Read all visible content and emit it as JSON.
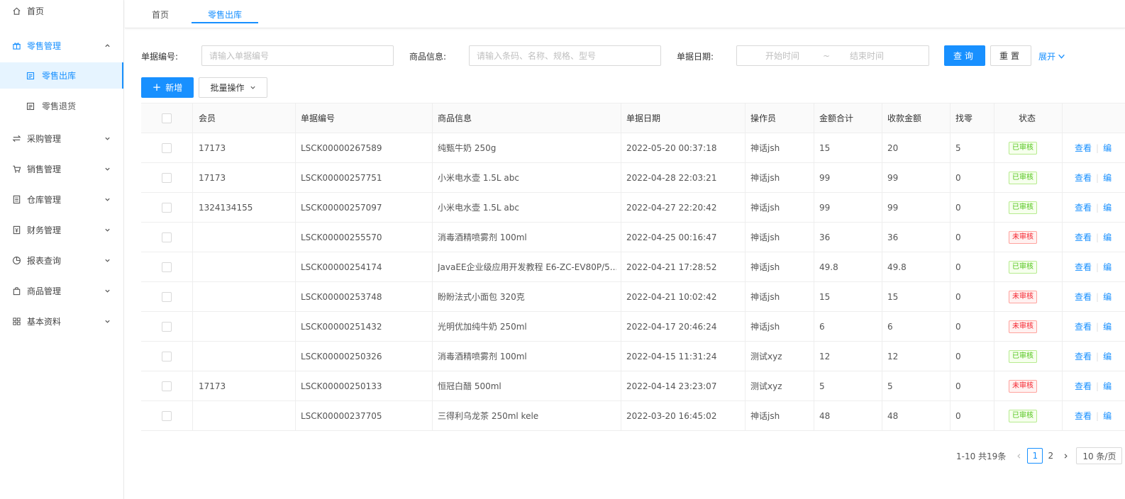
{
  "sidebar": {
    "items": [
      {
        "label": "首页",
        "icon": "home-icon"
      },
      {
        "label": "零售管理",
        "icon": "gift-icon",
        "open": true,
        "children": [
          {
            "label": "零售出库",
            "icon": "document-icon",
            "active": true
          },
          {
            "label": "零售退货",
            "icon": "document-icon"
          }
        ]
      },
      {
        "label": "采购管理",
        "icon": "swap-icon"
      },
      {
        "label": "销售管理",
        "icon": "cart-icon"
      },
      {
        "label": "仓库管理",
        "icon": "warehouse-icon"
      },
      {
        "label": "财务管理",
        "icon": "finance-icon"
      },
      {
        "label": "报表查询",
        "icon": "pie-chart-icon"
      },
      {
        "label": "商品管理",
        "icon": "shopping-bag-icon"
      },
      {
        "label": "基本资料",
        "icon": "grid-icon"
      }
    ]
  },
  "tabs": [
    {
      "label": "首页",
      "active": false
    },
    {
      "label": "零售出库",
      "active": true
    }
  ],
  "search": {
    "bill_no_label": "单据编号:",
    "bill_no_placeholder": "请输入单据编号",
    "goods_label": "商品信息:",
    "goods_placeholder": "请输入条码、名称、规格、型号",
    "date_label": "单据日期:",
    "date_start_placeholder": "开始时间",
    "date_separator": "~",
    "date_end_placeholder": "结束时间",
    "query_button": "查询",
    "reset_button": "重置",
    "expand_link": "展开"
  },
  "toolbar": {
    "add_button": "新增",
    "batch_button": "批量操作"
  },
  "table": {
    "columns": [
      "会员",
      "单据编号",
      "商品信息",
      "单据日期",
      "操作员",
      "金额合计",
      "收款金额",
      "找零",
      "状态"
    ],
    "rows": [
      {
        "member": "17173",
        "bill_no": "LSCK00000267589",
        "goods": "纯甄牛奶 250g",
        "date": "2022-05-20 00:37:18",
        "operator": "神话jsh",
        "total": "15",
        "received": "20",
        "change": "5",
        "status": "已审核",
        "approved": true
      },
      {
        "member": "17173",
        "bill_no": "LSCK00000257751",
        "goods": "小米电水壶 1.5L abc",
        "date": "2022-04-28 22:03:21",
        "operator": "神话jsh",
        "total": "99",
        "received": "99",
        "change": "0",
        "status": "已审核",
        "approved": true
      },
      {
        "member": "1324134155",
        "bill_no": "LSCK00000257097",
        "goods": "小米电水壶 1.5L abc",
        "date": "2022-04-27 22:20:42",
        "operator": "神话jsh",
        "total": "99",
        "received": "99",
        "change": "0",
        "status": "已审核",
        "approved": true
      },
      {
        "member": "",
        "bill_no": "LSCK00000255570",
        "goods": "消毒酒精喷雾剂 100ml",
        "date": "2022-04-25 00:16:47",
        "operator": "神话jsh",
        "total": "36",
        "received": "36",
        "change": "0",
        "status": "未审核",
        "approved": false
      },
      {
        "member": "",
        "bill_no": "LSCK00000254174",
        "goods": "JavaEE企业级应用开发教程 E6-ZC-EV80P/5...",
        "date": "2022-04-21 17:28:52",
        "operator": "神话jsh",
        "total": "49.8",
        "received": "49.8",
        "change": "0",
        "status": "已审核",
        "approved": true
      },
      {
        "member": "",
        "bill_no": "LSCK00000253748",
        "goods": "盼盼法式小面包 320克",
        "date": "2022-04-21 10:02:42",
        "operator": "神话jsh",
        "total": "15",
        "received": "15",
        "change": "0",
        "status": "未审核",
        "approved": false
      },
      {
        "member": "",
        "bill_no": "LSCK00000251432",
        "goods": "光明优加纯牛奶 250ml",
        "date": "2022-04-17 20:46:24",
        "operator": "神话jsh",
        "total": "6",
        "received": "6",
        "change": "0",
        "status": "未审核",
        "approved": false
      },
      {
        "member": "",
        "bill_no": "LSCK00000250326",
        "goods": "消毒酒精喷雾剂 100ml",
        "date": "2022-04-15 11:31:24",
        "operator": "测试xyz",
        "total": "12",
        "received": "12",
        "change": "0",
        "status": "已审核",
        "approved": true
      },
      {
        "member": "17173",
        "bill_no": "LSCK00000250133",
        "goods": "恒冠白醋 500ml",
        "date": "2022-04-14 23:23:07",
        "operator": "测试xyz",
        "total": "5",
        "received": "5",
        "change": "0",
        "status": "未审核",
        "approved": false
      },
      {
        "member": "",
        "bill_no": "LSCK00000237705",
        "goods": "三得利乌龙茶 250ml kele",
        "date": "2022-03-20 16:45:02",
        "operator": "神话jsh",
        "total": "48",
        "received": "48",
        "change": "0",
        "status": "已审核",
        "approved": true
      }
    ],
    "action_view": "查看",
    "action_edit": "编"
  },
  "pagination": {
    "summary": "1-10 共19条",
    "pages": [
      "1",
      "2"
    ],
    "current": "1",
    "page_size": "10 条/页"
  },
  "colors": {
    "primary": "#1890ff",
    "success": "#52c41a",
    "danger": "#f5222d"
  }
}
